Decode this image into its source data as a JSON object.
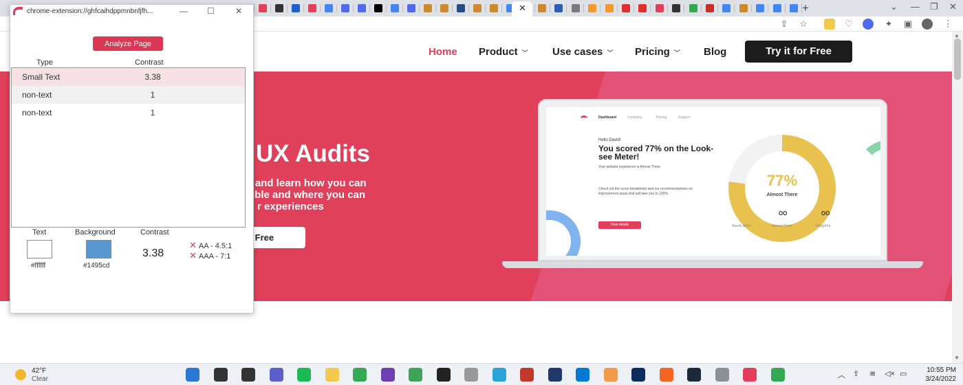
{
  "browser": {
    "active_tab_close": "✕",
    "new_tab": "+",
    "tab_colors": [
      "#6d7ff5",
      "#7a8cf0",
      "#f2c94c",
      "#4d7dd6",
      "#e2405a",
      "#333333",
      "#1e5fd1",
      "#e2405a",
      "#4285f4",
      "#4f6af0",
      "#4f6af0",
      "#000000",
      "#4285f4",
      "#4f6af0",
      "#cc8a2c",
      "#cc8a2c",
      "#274b86",
      "#cc8a2c",
      "#cc8a2c",
      "#4285f4",
      "#34a853"
    ],
    "tab_colors_right": [
      "#cc8a2c",
      "#2b5fb5",
      "#7a7a7a",
      "#f29a2c",
      "#f29a2c",
      "#e02d2d",
      "#e02d2d",
      "#e2405a",
      "#333333",
      "#34a853",
      "#c4302b",
      "#4285f4",
      "#cc8a2c",
      "#4285f4",
      "#4285f4",
      "#4285f4"
    ],
    "window_controls": [
      "⌄",
      "—",
      "❐",
      "✕"
    ]
  },
  "site": {
    "nav": {
      "home": "Home",
      "product": "Product",
      "use_cases": "Use cases",
      "pricing": "Pricing",
      "blog": "Blog",
      "cta": "Try it for Free"
    },
    "hero": {
      "title": "UX Audits",
      "subtitle_line1": "es and learn how you can",
      "subtitle_line2": "ible and where you can",
      "subtitle_line3": "r experiences",
      "button": "r Free"
    },
    "laptop": {
      "nav": [
        "Dashboard",
        "Company",
        "Pricing",
        "Support"
      ],
      "hello": "Hello David!",
      "title": "You scored 77% on the Look-see Meter!",
      "body1": "Your website experience is Almost There",
      "body2": "Check out the score breakdown and our recommendations on improvement areas that will take you to 100%.",
      "button": "View details",
      "score_pct": "77%",
      "score_label": "Almost There",
      "score_fraction": 0.77,
      "stats": [
        "Needs Work",
        "Almost There",
        "Delightful"
      ],
      "stat_big": "OO"
    }
  },
  "popup": {
    "title": "chrome-extension://ghfcaihdppmnbnfjfh...",
    "controls": [
      "—",
      "☐",
      "✕"
    ],
    "analyze_button": "Analyze Page",
    "columns": {
      "type": "Type",
      "contrast": "Contrast"
    },
    "rows": [
      {
        "type": "Small Text",
        "contrast": "3.38"
      },
      {
        "type": "non-text",
        "contrast": "1"
      },
      {
        "type": "non-text",
        "contrast": "1"
      }
    ],
    "detail": {
      "text_label": "Text",
      "background_label": "Background",
      "contrast_label": "Contrast",
      "text_color": "#ffffff",
      "text_hex": "#ffffff",
      "background_color": "#5a98d1",
      "background_hex": "#1495cd",
      "ratio": "3.38",
      "aa": "AA - 4.5:1",
      "aaa": "AAA - 7:1"
    }
  },
  "taskbar": {
    "temp": "42°F",
    "condition": "Clear",
    "time": "10:55 PM",
    "date": "3/24/2022",
    "app_colors": [
      "#2b79d6",
      "#333333",
      "#333333",
      "#5b5fc7",
      "#1db954",
      "#f2c94c",
      "#34a853",
      "#6e3fb0",
      "#3fa35a",
      "#222222",
      "#999999",
      "#2aa3d9",
      "#c0392b",
      "#1f3a68",
      "#0078d4",
      "#f2994a",
      "#0a2b5c",
      "#f26522",
      "#1b2838",
      "#8a8f98",
      "#e2405a",
      "#34a853"
    ]
  }
}
